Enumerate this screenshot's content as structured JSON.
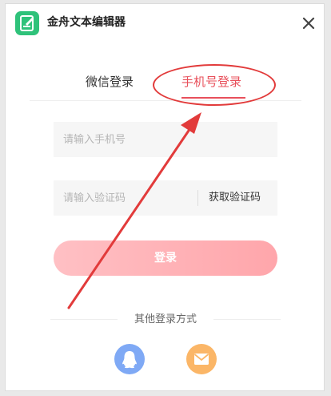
{
  "window": {
    "title": "金舟文本编辑器"
  },
  "tabs": [
    {
      "label": "微信登录",
      "active": false
    },
    {
      "label": "手机号登录",
      "active": true
    }
  ],
  "form": {
    "phone_placeholder": "请输入手机号",
    "phone_value": "",
    "code_placeholder": "请输入验证码",
    "code_value": "",
    "get_code_label": "获取验证码",
    "login_label": "登录"
  },
  "other_login": {
    "label": "其他登录方式",
    "methods": [
      {
        "icon": "qq-icon",
        "color": "#7fa9f5"
      },
      {
        "icon": "mail-icon",
        "color": "#fbb667"
      }
    ]
  },
  "colors": {
    "accent": "#e8505b",
    "brand_green": "#2fc27a",
    "annotation_red": "#e23b3b",
    "login_gradient_start": "#ffc0c4",
    "login_gradient_end": "#ffa6ab"
  }
}
